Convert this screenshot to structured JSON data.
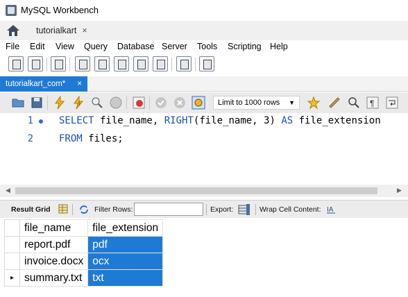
{
  "window": {
    "title": "MySQL Workbench"
  },
  "tabs": {
    "connection_tab": "tutorialkart",
    "close_glyph": "×"
  },
  "menu": [
    "File",
    "Edit",
    "View",
    "Query",
    "Database",
    "Server",
    "Tools",
    "Scripting",
    "Help"
  ],
  "editor_tab": {
    "label": "tutorialkart_com*",
    "close_glyph": "×"
  },
  "sql_toolbar": {
    "limit_label": "Limit to 1000 rows"
  },
  "editor": {
    "lines": [
      {
        "number": "1",
        "keyword_a": "SELECT",
        "text_a": " file_name, ",
        "keyword_b": "RIGHT",
        "text_b": "(file_name, ",
        "num": "3",
        "text_c": ") ",
        "keyword_c": "AS",
        "text_d": " file_extension"
      },
      {
        "number": "2",
        "keyword_a": "FROM",
        "text_a": " files;"
      }
    ]
  },
  "result_toolbar": {
    "result_grid": "Result Grid",
    "filter_rows": "Filter Rows:",
    "export": "Export:",
    "wrap": "Wrap Cell Content:"
  },
  "result_grid": {
    "columns": [
      "file_name",
      "file_extension"
    ],
    "rows": [
      [
        "report.pdf",
        "pdf"
      ],
      [
        "invoice.docx",
        "ocx"
      ],
      [
        "summary.txt",
        "txt"
      ]
    ],
    "current_row_marker": "▸"
  }
}
